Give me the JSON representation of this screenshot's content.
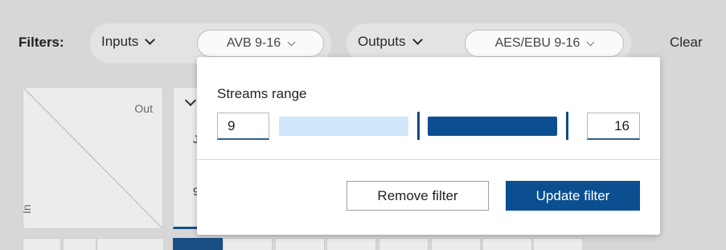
{
  "filters": {
    "label": "Filters:",
    "clear_label": "Clear",
    "inputs": {
      "label": "Inputs",
      "value": "AVB 9-16"
    },
    "outputs": {
      "label": "Outputs",
      "value": "AES/EBU 9-16"
    }
  },
  "matrix": {
    "corner_out_label": "Out",
    "corner_in_label": "In",
    "partial_col_text1": "J",
    "partial_col_text2": "9"
  },
  "popover": {
    "title": "Streams range",
    "range_min": "9",
    "range_max": "16",
    "remove_button": "Remove filter",
    "update_button": "Update filter"
  },
  "colors": {
    "accent": "#0b4f91",
    "slider_inactive": "#cfe6fb",
    "background": "#d7d7d7"
  }
}
